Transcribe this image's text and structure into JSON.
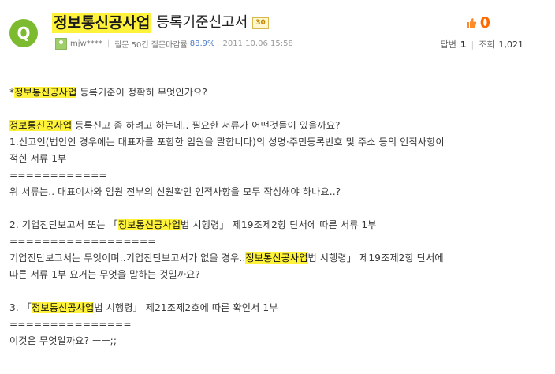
{
  "header": {
    "badge_letter": "Q",
    "title_highlight": "정보통신공사업",
    "title_rest": "등록기준신고서",
    "points": "30",
    "user": "mjw****",
    "question_stats": "질문 50건 질문마감률",
    "close_rate": "88.9%",
    "date": "2011.10.06 15:58",
    "score": "0",
    "answers_label": "답변",
    "answers_count": "1",
    "views_label": "조회",
    "views_count": "1,021",
    "thumb_icon": "thumbs-up-icon",
    "highlight_color": "#fff23a",
    "accent_green": "#7cbb2f",
    "accent_orange": "#ff6a00"
  },
  "content": {
    "l1_pre": "*",
    "l1_hl": "정보통신공사업",
    "l1_post": " 등록기준이 정확히 무엇인가요?",
    "l2_hl": "정보통신공사업",
    "l2_post": " 등록신고 좀 하려고 하는데.. 필요한 서류가 어떤것들이 있을까요?",
    "l3": "1.신고인(법인인 경우에는 대표자를 포함한 임원을 말합니다)의 성명·주민등록번호 및 주소 등의 인적사항이",
    "l4": "적힌 서류 1부",
    "l5": "============",
    "l6": "위 서류는.. 대표이사와 임원 전부의 신원확인 인적사항을 모두 작성해야 하나요..?",
    "l7_pre": "2. 기업진단보고서 또는 「",
    "l7_hl": "정보통신공사업",
    "l7_post": "법 시행령」 제19조제2항 단서에 따른 서류 1부",
    "l8": "==================",
    "l9_pre": "기업진단보고서는 무엇이며..기업진단보고서가 없을 경우..",
    "l9_hl": "정보통신공사업",
    "l9_post": "법 시행령」 제19조제2항 단서에",
    "l10": "따른 서류 1부 요거는 무엇을 말하는 것일까요?",
    "l11_pre": "3. 「",
    "l11_hl": "정보통신공사업",
    "l11_post": "법 시행령」 제21조제2호에 따른 확인서 1부",
    "l12": "===============",
    "l13": "이것은 무엇일까요? ㅡㅡ;;"
  }
}
